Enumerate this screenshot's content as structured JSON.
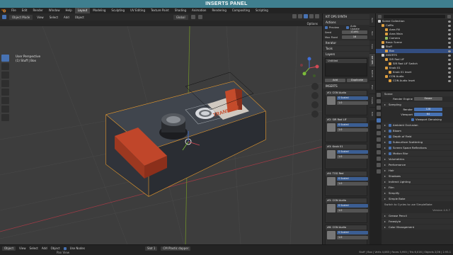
{
  "banner": {
    "title": "INSERTS PANEL"
  },
  "topbar": {
    "workspaces": [
      "File",
      "Edit",
      "Render",
      "Window",
      "Help",
      "Layout",
      "Modeling",
      "Sculpting",
      "UV Editing",
      "Texture Paint",
      "Shading",
      "Animation",
      "Rendering",
      "Compositing",
      "Scripting"
    ],
    "active_workspace": "Layout"
  },
  "view_header": {
    "mode": "Object Mode",
    "menus": [
      "View",
      "Select",
      "Add",
      "Object"
    ],
    "transform": "Global",
    "options": "Options"
  },
  "viewport": {
    "info_line1": "User Perspective",
    "info_line2": "(1) Stuff | Box",
    "decal_text": "TRANSFER"
  },
  "n_panel": {
    "title": "KIT OPS SYNTH",
    "actions_label": "Actions",
    "preview_label": "Preview",
    "auto_update_label": "Auto Update",
    "seed_label": "Seed",
    "seed_value": "11491",
    "max_fixed_label": "Max Fixed",
    "max_fixed_value": "16",
    "iterator_label": "Iterator",
    "tools_label": "Tools",
    "layers_label": "Layers",
    "layer_name": "Untitled",
    "add_label": "Add",
    "duplicate_label": "Duplicate",
    "inserts_label": "INSERTS",
    "slots": [
      {
        "name": "#1: CON Audio",
        "scale_label": "S Scaled",
        "scale_value": "1.0"
      },
      {
        "name": "#2: SIR Rod LIF",
        "scale_label": "S Scaled",
        "scale_value": "1.0"
      },
      {
        "name": "#3: Knob 01",
        "scale_label": "S Scaled",
        "scale_value": "1.0"
      },
      {
        "name": "#4: TOG Red",
        "scale_label": "S Scaled",
        "scale_value": "1.0"
      },
      {
        "name": "#5: CON Audio",
        "scale_label": "S Scaled",
        "scale_value": "1.0"
      },
      {
        "name": "#6: CON Audio",
        "scale_label": "S Scaled",
        "scale_value": "1.0"
      }
    ]
  },
  "n_tabs": [
    "Item",
    "Tool",
    "View",
    "KIT OPS",
    "BATCH",
    "HSA",
    "Create",
    "Edit"
  ],
  "outliner": {
    "title": "Scene Collection",
    "items": [
      {
        "label": "Scene Collection",
        "color": "#cccccc",
        "selected": false,
        "indent": 0
      },
      {
        "label": "Coffin",
        "color": "#e0a040",
        "selected": false,
        "indent": 1
      },
      {
        "label": "Area Fill",
        "color": "#e0a040",
        "selected": false,
        "indent": 2
      },
      {
        "label": "Area Main",
        "color": "#e0a040",
        "selected": false,
        "indent": 2
      },
      {
        "label": "Camera",
        "color": "#90c060",
        "selected": false,
        "indent": 2
      },
      {
        "label": "Basic Scene",
        "color": "#e0a040",
        "selected": false,
        "indent": 1
      },
      {
        "label": "Stuff",
        "color": "#cccccc",
        "selected": false,
        "indent": 1
      },
      {
        "label": "Box",
        "color": "#e0a040",
        "selected": true,
        "indent": 2
      },
      {
        "label": "INSERTS",
        "color": "#cccccc",
        "selected": false,
        "indent": 1
      },
      {
        "label": "SIR Rod LIF",
        "color": "#e0a040",
        "selected": false,
        "indent": 2
      },
      {
        "label": "SIR Rod LIF Switch",
        "color": "#e0a040",
        "selected": false,
        "indent": 3
      },
      {
        "label": "Knob 01",
        "color": "#e0a040",
        "selected": false,
        "indent": 2
      },
      {
        "label": "Knob 01 Inset",
        "color": "#e0a040",
        "selected": false,
        "indent": 3
      },
      {
        "label": "CON Audio",
        "color": "#e0a040",
        "selected": false,
        "indent": 2
      },
      {
        "label": "CON Audio Inset",
        "color": "#e0a040",
        "selected": false,
        "indent": 3
      }
    ]
  },
  "properties": {
    "scene_label": "Scene",
    "render_engine_label": "Render Engine",
    "render_engine_value": "Eevee",
    "sampling_label": "Sampling",
    "render_label": "Render",
    "render_value": "128",
    "viewport_label": "Viewport",
    "viewport_value": "64",
    "viewport_denoising_label": "Viewport Denoising",
    "sections": [
      "Ambient Occlusion",
      "Bloom",
      "Depth of Field",
      "Subsurface Scattering",
      "Screen Space Reflections",
      "Motion Blur",
      "Volumetrics",
      "Performance",
      "Hair",
      "Shadows",
      "Indirect Lighting",
      "Film",
      "Simplify",
      "Simple Bake"
    ],
    "note": "Switch to Cycles to use SimpleBake",
    "version": "Version 4.9.7",
    "bottom_sections": [
      "Grease Pencil",
      "Freestyle",
      "Color Management"
    ]
  },
  "statusbar": {
    "mode": "Object",
    "menus": [
      "View",
      "Select",
      "Add",
      "Object"
    ],
    "use_nodes": "Use Nodes",
    "slot": "Slot 1",
    "material": "CM Plastic dapper",
    "pan_view": "Pan View",
    "stats": "Stuff | Box | Verts 4,083 | Faces 3,955 | Tris 6,016 | Objects 2/26 | 2.93.1"
  }
}
